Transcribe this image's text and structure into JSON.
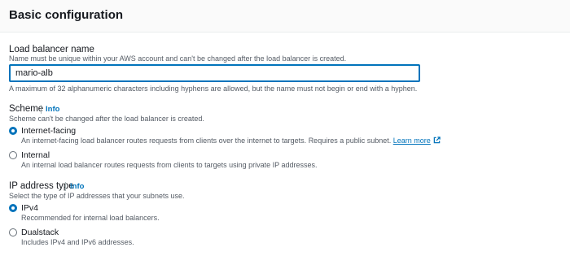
{
  "section": {
    "title": "Basic configuration"
  },
  "lb_name": {
    "label": "Load balancer name",
    "hint": "Name must be unique within your AWS account and can't be changed after the load balancer is created.",
    "value": "mario-alb",
    "constraint": "A maximum of 32 alphanumeric characters including hyphens are allowed, but the name must not begin or end with a hyphen."
  },
  "scheme": {
    "label": "Scheme",
    "info": "Info",
    "hint": "Scheme can't be changed after the load balancer is created.",
    "options": [
      {
        "label": "Internet-facing",
        "description": "An internet-facing load balancer routes requests from clients over the internet to targets. Requires a public subnet.",
        "link": "Learn more",
        "selected": true
      },
      {
        "label": "Internal",
        "description": "An internal load balancer routes requests from clients to targets using private IP addresses.",
        "selected": false
      }
    ]
  },
  "ip_type": {
    "label": "IP address type",
    "info": "Info",
    "hint": "Select the type of IP addresses that your subnets use.",
    "options": [
      {
        "label": "IPv4",
        "description": "Recommended for internal load balancers.",
        "selected": true
      },
      {
        "label": "Dualstack",
        "description": "Includes IPv4 and IPv6 addresses.",
        "selected": false
      }
    ]
  },
  "colors": {
    "accent": "#0073bb",
    "text": "#16191f",
    "muted": "#545b64"
  },
  "icons": {
    "external": "external-link-icon"
  }
}
